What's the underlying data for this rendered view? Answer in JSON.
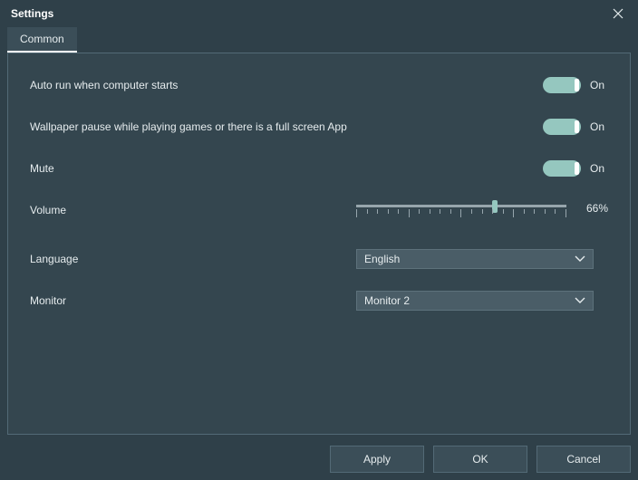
{
  "window": {
    "title": "Settings"
  },
  "tabs": {
    "common": "Common"
  },
  "settings": {
    "autorun": {
      "label": "Auto run when computer starts",
      "state": "On"
    },
    "pause": {
      "label": "Wallpaper pause while playing games or there is a full screen App",
      "state": "On"
    },
    "mute": {
      "label": "Mute",
      "state": "On"
    },
    "volume": {
      "label": "Volume",
      "percent": 66,
      "readout": "66%"
    },
    "language": {
      "label": "Language",
      "value": "English"
    },
    "monitor": {
      "label": "Monitor",
      "value": "Monitor 2"
    }
  },
  "buttons": {
    "apply": "Apply",
    "ok": "OK",
    "cancel": "Cancel"
  }
}
